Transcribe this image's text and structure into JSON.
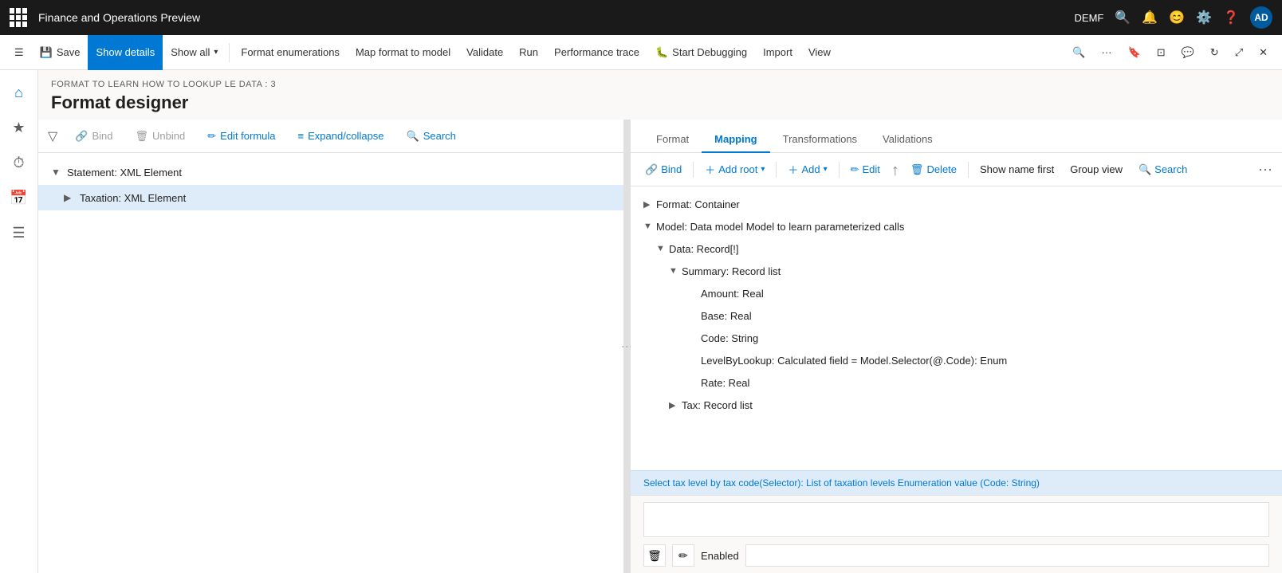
{
  "titleBar": {
    "appTitle": "Finance and Operations Preview",
    "userCode": "DEMF",
    "avatarText": "AD"
  },
  "commandBar": {
    "saveLabel": "Save",
    "showDetailsLabel": "Show details",
    "showAllLabel": "Show all",
    "formatEnumerationsLabel": "Format enumerations",
    "mapFormatToModelLabel": "Map format to model",
    "validateLabel": "Validate",
    "runLabel": "Run",
    "performanceTraceLabel": "Performance trace",
    "startDebuggingLabel": "Start Debugging",
    "importLabel": "Import",
    "viewLabel": "View"
  },
  "pageHeader": {
    "breadcrumb": "FORMAT TO LEARN HOW TO LOOKUP LE DATA : 3",
    "title": "Format designer"
  },
  "leftPaneToolbar": {
    "bindLabel": "Bind",
    "unbindLabel": "Unbind",
    "editFormulaLabel": "Edit formula",
    "expandCollapseLabel": "Expand/collapse",
    "searchLabel": "Search"
  },
  "treeItems": [
    {
      "label": "Statement: XML Element",
      "expanded": true,
      "indent": 0,
      "hasExpand": true,
      "expandChar": "▼"
    },
    {
      "label": "Taxation: XML Element",
      "expanded": false,
      "indent": 1,
      "hasExpand": true,
      "expandChar": "▶",
      "selected": true
    }
  ],
  "tabs": [
    {
      "label": "Format",
      "active": false
    },
    {
      "label": "Mapping",
      "active": true
    },
    {
      "label": "Transformations",
      "active": false
    },
    {
      "label": "Validations",
      "active": false
    }
  ],
  "mappingToolbar": {
    "bindLabel": "Bind",
    "addRootLabel": "Add root",
    "addLabel": "Add",
    "editLabel": "Edit",
    "deleteLabel": "Delete",
    "showNameFirstLabel": "Show name first",
    "groupViewLabel": "Group view",
    "searchLabel": "Search"
  },
  "mappingTree": [
    {
      "label": "Format: Container",
      "indent": 0,
      "expand": "▶",
      "icon": ""
    },
    {
      "label": "Model: Data model Model to learn parameterized calls",
      "indent": 0,
      "expand": "▼",
      "icon": ""
    },
    {
      "label": "Data: Record[!]",
      "indent": 1,
      "expand": "▼",
      "icon": ""
    },
    {
      "label": "Summary: Record list",
      "indent": 2,
      "expand": "▼",
      "icon": ""
    },
    {
      "label": "Amount: Real",
      "indent": 3,
      "expand": "",
      "icon": ""
    },
    {
      "label": "Base: Real",
      "indent": 3,
      "expand": "",
      "icon": ""
    },
    {
      "label": "Code: String",
      "indent": 3,
      "expand": "",
      "icon": ""
    },
    {
      "label": "LevelByLookup: Calculated field = Model.Selector(@.Code): Enum",
      "indent": 3,
      "expand": "",
      "icon": ""
    },
    {
      "label": "Rate: Real",
      "indent": 3,
      "expand": "",
      "icon": ""
    },
    {
      "label": "Tax: Record list",
      "indent": 2,
      "expand": "▶",
      "icon": ""
    }
  ],
  "selectedItem": {
    "text": "Select tax level by tax code(Selector): List of taxation levels Enumeration value (Code: String)"
  },
  "formulaArea": {
    "placeholder": "",
    "enabledLabel": "Enabled",
    "enabledValue": ""
  }
}
